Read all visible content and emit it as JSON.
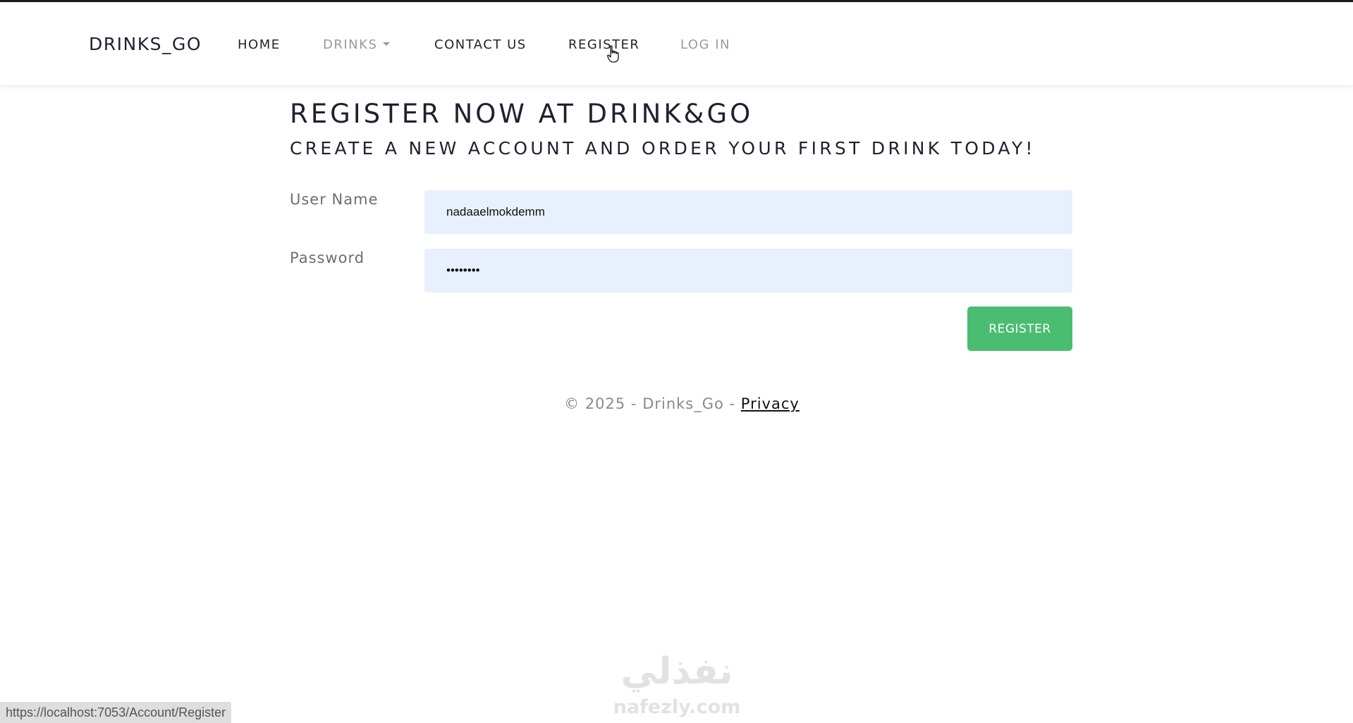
{
  "navbar": {
    "brand": "DRINKS_GO",
    "items": [
      {
        "label": "HOME",
        "state": "default"
      },
      {
        "label": "DRINKS",
        "state": "muted",
        "has_dropdown": true
      },
      {
        "label": "CONTACT US",
        "state": "default"
      },
      {
        "label": "REGISTER",
        "state": "default"
      },
      {
        "label": "LOG IN",
        "state": "muted"
      }
    ]
  },
  "page": {
    "title": "REGISTER NOW AT DRINK&GO",
    "subtitle": "CREATE A NEW ACCOUNT AND ORDER YOUR FIRST DRINK TODAY!"
  },
  "form": {
    "username_label": "User Name",
    "username_value": "nadaaelmokdemm",
    "password_label": "Password",
    "password_value": "••••••••",
    "submit_label": "REGISTER",
    "submit_color": "#4bbd71",
    "input_bg": "#e8f0fe"
  },
  "footer": {
    "text": "© 2025 - Drinks_Go - ",
    "privacy_link": "Privacy"
  },
  "status_bar": {
    "url": "https://localhost:7053/Account/Register"
  },
  "watermark": {
    "arabic": "نفذلي",
    "latin": "nafezly.com"
  }
}
